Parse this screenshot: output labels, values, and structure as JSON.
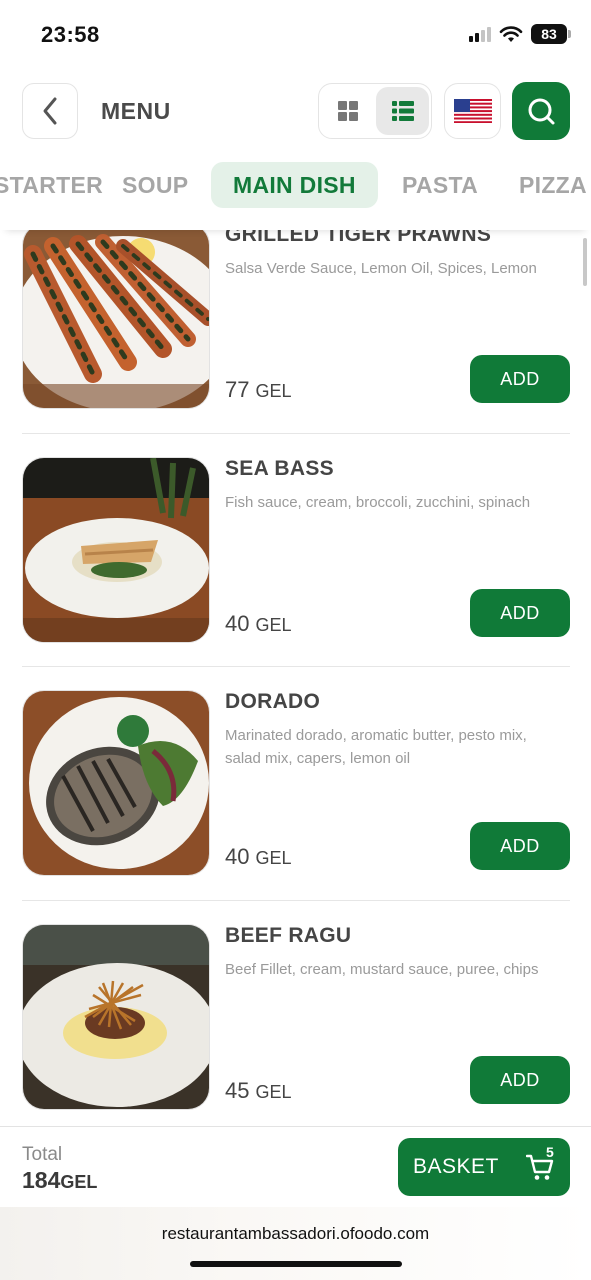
{
  "status_bar": {
    "time": "23:58",
    "battery": "83"
  },
  "header": {
    "title": "MENU",
    "icons": {
      "back": "chevron-left-icon",
      "grid_view": "grid-icon",
      "list_view": "list-icon",
      "language": "us-flag-icon",
      "search": "search-icon"
    }
  },
  "tabs": [
    {
      "label": "STARTER",
      "active": false
    },
    {
      "label": "SOUP",
      "active": false
    },
    {
      "label": "MAIN DISH",
      "active": true
    },
    {
      "label": "PASTA",
      "active": false
    },
    {
      "label": "PIZZA",
      "active": false
    }
  ],
  "menu_items": [
    {
      "name": "GRILLED TIGER PRAWNS",
      "description": "Salsa Verde Sauce, Lemon Oil, Spices, Lemon",
      "price": "77",
      "currency": "GEL",
      "add_label": "ADD"
    },
    {
      "name": "SEA BASS",
      "description": "Fish sauce, cream, broccoli, zucchini, spinach",
      "price": "40",
      "currency": "GEL",
      "add_label": "ADD"
    },
    {
      "name": "DORADO",
      "description": "Marinated dorado, aromatic butter, pesto mix, salad mix, capers, lemon oil",
      "price": "40",
      "currency": "GEL",
      "add_label": "ADD"
    },
    {
      "name": "BEEF RAGU",
      "description": "Beef Fillet, cream, mustard sauce, puree, chips",
      "price": "45",
      "currency": "GEL",
      "add_label": "ADD"
    }
  ],
  "basket_bar": {
    "total_label": "Total",
    "total_value": "184",
    "total_currency": "GEL",
    "basket_label": "BASKET",
    "basket_count": "5",
    "basket_icon": "cart-icon"
  },
  "browser": {
    "url": "restaurantambassadori.ofoodo.com"
  },
  "colors": {
    "accent": "#107a38",
    "tab_active_bg": "#e4f1e8",
    "text_muted": "#9a9a9a"
  }
}
